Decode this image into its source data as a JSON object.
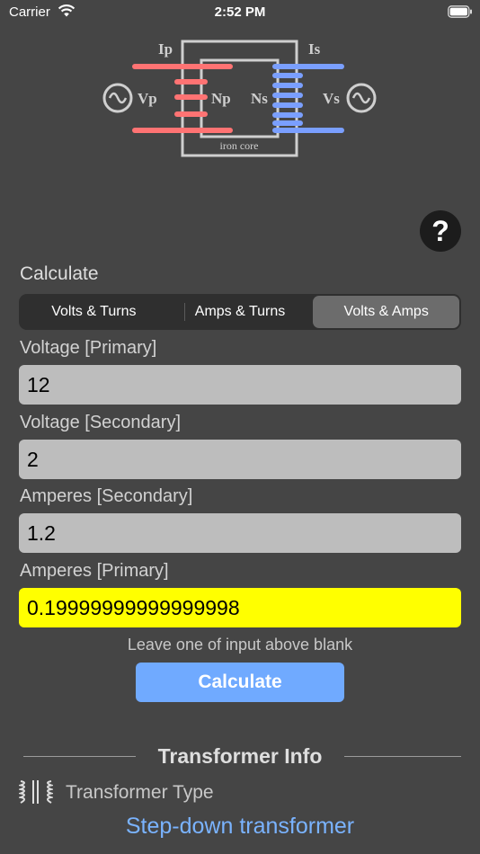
{
  "status_bar": {
    "carrier": "Carrier",
    "time": "2:52 PM"
  },
  "diagram": {
    "primary_current": "Ip",
    "secondary_current": "Is",
    "primary_voltage": "Vp",
    "secondary_voltage": "Vs",
    "primary_turns": "Np",
    "secondary_turns": "Ns",
    "core_label": "iron core",
    "colors": {
      "primary": "#ff7373",
      "secondary": "#7a9fff",
      "core": "#cfcfcf"
    }
  },
  "help": {
    "label": "?"
  },
  "calculate": {
    "title": "Calculate",
    "modes": [
      "Volts & Turns",
      "Amps & Turns",
      "Volts & Amps"
    ],
    "selected_mode": "Volts & Amps"
  },
  "fields": {
    "voltage_primary": {
      "label": "Voltage [Primary]",
      "value": "12"
    },
    "voltage_secondary": {
      "label": "Voltage [Secondary]",
      "value": "2"
    },
    "amperes_secondary": {
      "label": "Amperes [Secondary]",
      "value": "1.2"
    },
    "amperes_primary": {
      "label": "Amperes [Primary]",
      "value": "0.19999999999999998"
    }
  },
  "hint": "Leave one of input above blank",
  "calculate_button": "Calculate",
  "info": {
    "title": "Transformer Info",
    "type_label": "Transformer Type",
    "type_value": "Step-down transformer"
  },
  "colors": {
    "background": "#454545",
    "field": "#bdbdbd",
    "result_field": "#ffff00",
    "button": "#70aaff",
    "link": "#7ab3ff"
  }
}
